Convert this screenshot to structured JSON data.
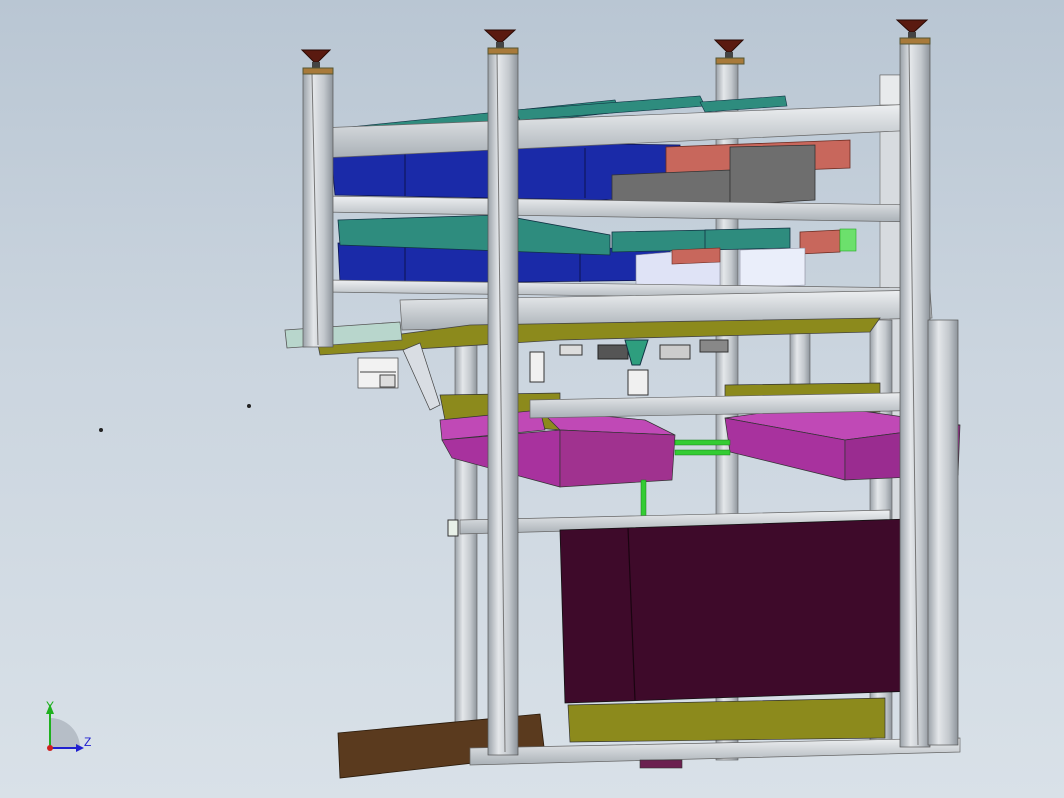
{
  "viewport": {
    "background_top": "#b9c6d3",
    "background_bottom": "#d9e1e8"
  },
  "triad": {
    "y_label": "Y",
    "z_label": "Z",
    "y_color": "#1fb01f",
    "z_color": "#2020d0",
    "x_color": "#d02020"
  },
  "model": {
    "frame_color": "#c8cdd2",
    "colors": {
      "blue_bins": "#1a2aa8",
      "teal_rails": "#2e8c7e",
      "salmon": "#c8675c",
      "gray_box": "#6e6e6e",
      "olive": "#8c8a1c",
      "magenta": "#a8329e",
      "maroon": "#3e0a2a",
      "brown_base": "#5a3a1e",
      "feet": "#5a1a10",
      "green_links": "#33cc33"
    }
  }
}
